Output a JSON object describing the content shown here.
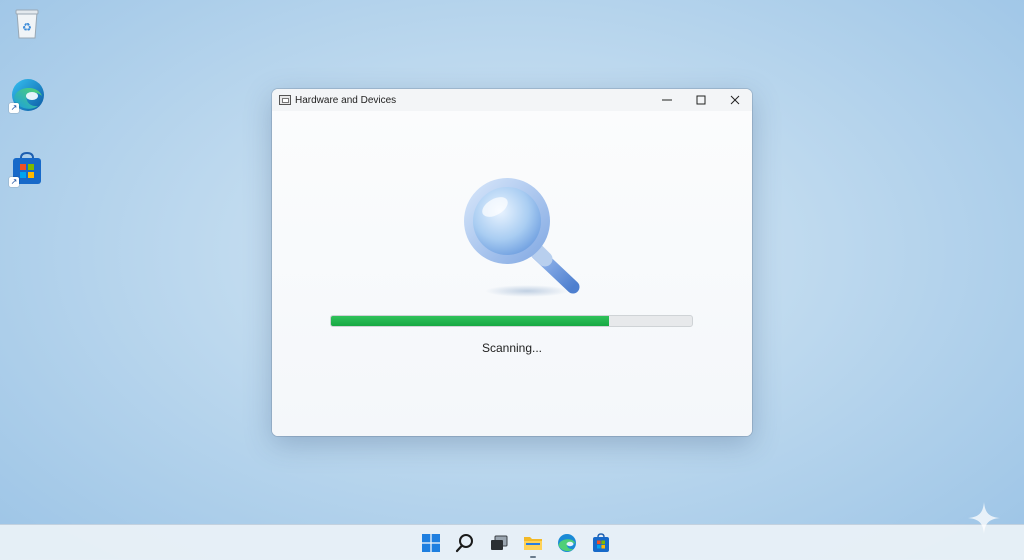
{
  "desktop": {
    "icons": [
      {
        "name": "recycle-bin-icon"
      },
      {
        "name": "edge-icon"
      },
      {
        "name": "store-icon"
      }
    ]
  },
  "window": {
    "title": "Hardware and Devices",
    "controls": {
      "minimize": "—",
      "maximize": "☐",
      "close": "✕"
    },
    "progress": {
      "value": 0.77,
      "color": "#1fb14c"
    },
    "status": "Scanning..."
  },
  "taskbar": {
    "icons": [
      "start-icon",
      "search-icon",
      "task-view-icon",
      "file-explorer-icon",
      "edge-icon",
      "store-icon"
    ]
  },
  "colors": {
    "accent": "#1fb14c",
    "desktop_bg": "#bcd8ee"
  }
}
